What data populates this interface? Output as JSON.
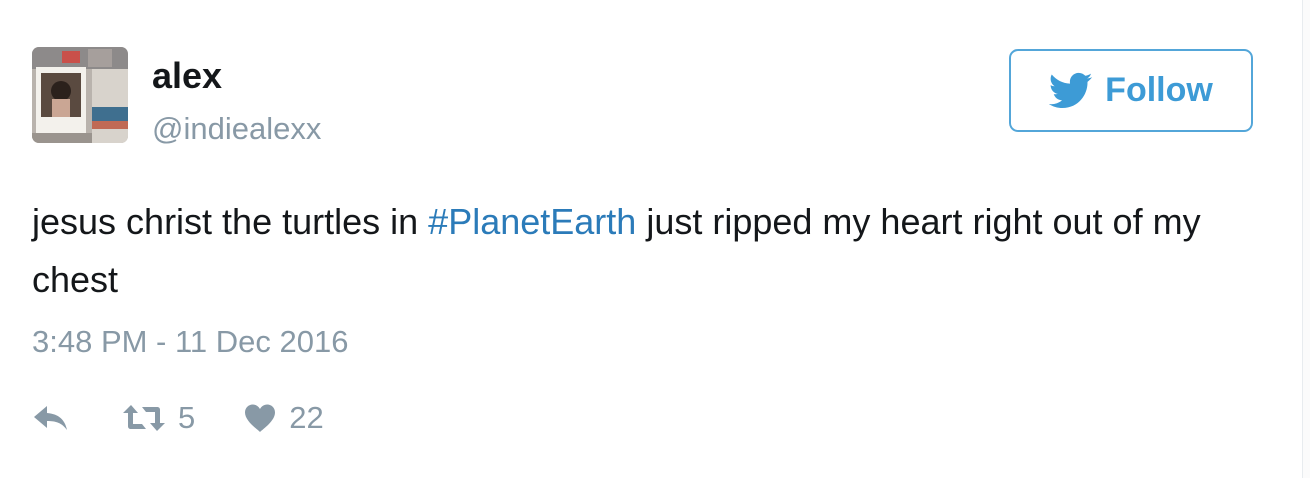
{
  "user": {
    "display_name": "alex",
    "handle": "@indiealexx"
  },
  "follow_button": {
    "label": "Follow",
    "icon": "twitter-bird-icon"
  },
  "tweet": {
    "text_before": "jesus christ the turtles in ",
    "hashtag": "#PlanetEarth",
    "text_after": " just ripped my heart right out of my chest",
    "timestamp": "3:48 PM - 11 Dec 2016"
  },
  "actions": {
    "reply_icon": "reply-icon",
    "retweet_icon": "retweet-icon",
    "retweet_count": "5",
    "like_icon": "heart-icon",
    "like_count": "22"
  },
  "colors": {
    "accent": "#1da1f2",
    "link": "#2b7bb9",
    "text": "#14171a",
    "muted": "#8899a6"
  }
}
